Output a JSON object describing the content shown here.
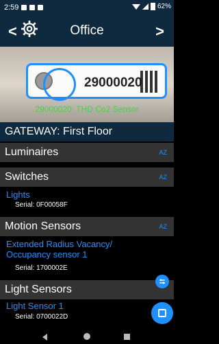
{
  "status_bar": {
    "time": "2:59",
    "battery": "62%"
  },
  "header": {
    "title": "Office",
    "back": "<",
    "next": ">"
  },
  "photo": {
    "serial_printed": "29000020",
    "caption": "29000020: THD Co2 Sensor"
  },
  "gateway": {
    "label": "GATEWAY: First Floor"
  },
  "sections": {
    "luminaires": {
      "title": "Luminaires",
      "sort": "AZ"
    },
    "switches": {
      "title": "Switches",
      "sort": "AZ",
      "items": [
        {
          "name": "Lights",
          "serial": "Serial: 0F00058F"
        }
      ]
    },
    "motion": {
      "title": "Motion Sensors",
      "sort": "AZ",
      "items": [
        {
          "name_line1": "Extended Radius Vacancy/",
          "name_line2": "Occupancy sensor 1",
          "serial": "Serial: 1700002E"
        }
      ]
    },
    "light": {
      "title": "Light Sensors",
      "items": [
        {
          "name": "Light Sensor 1",
          "serial": "Serial: 0700022D"
        }
      ]
    }
  },
  "colors": {
    "accent": "#1e90ff",
    "header_bg": "#0f2a3e",
    "section_bg": "#333333",
    "caption": "#48d048"
  }
}
